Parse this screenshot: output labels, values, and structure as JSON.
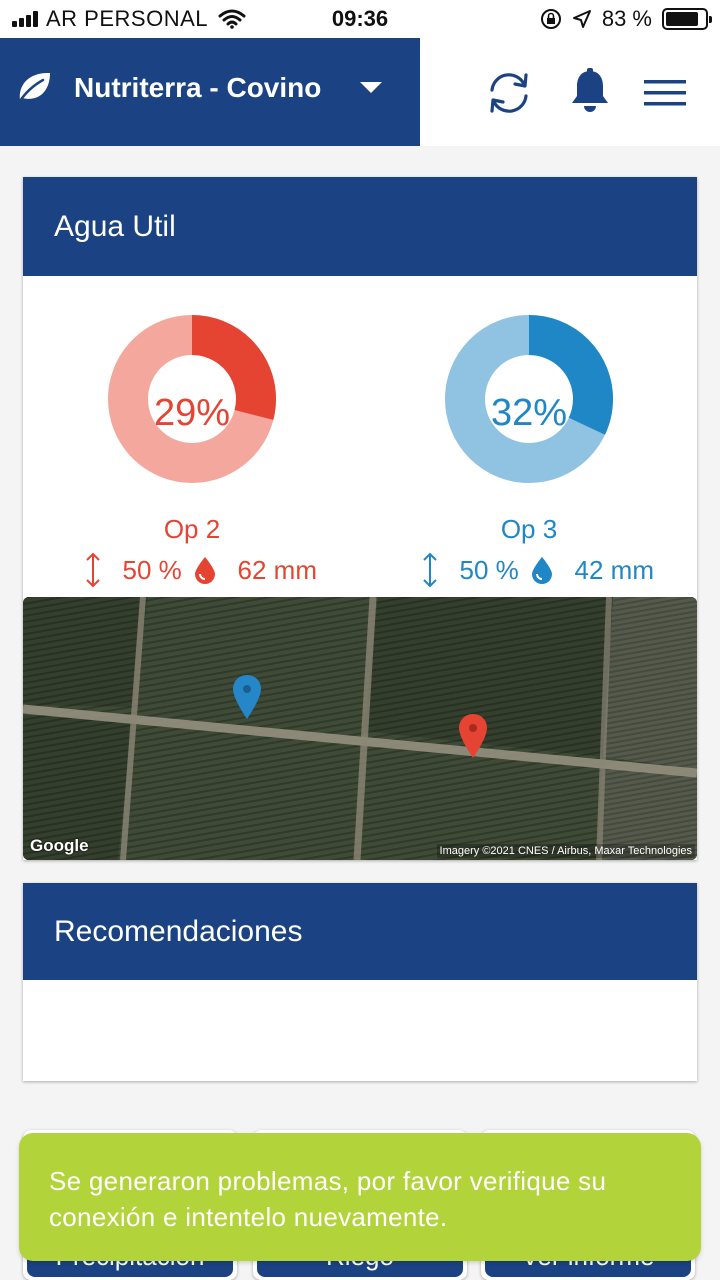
{
  "status_bar": {
    "carrier": "AR PERSONAL",
    "time": "09:36",
    "battery": "83 %",
    "battery_level": 0.83
  },
  "header": {
    "title": "Nutriterra - Covino",
    "icons": [
      "leaf-icon",
      "dropdown-caret-icon",
      "refresh-icon",
      "bell-icon",
      "menu-icon"
    ]
  },
  "agua_util": {
    "title": "Agua Util",
    "sensors": [
      {
        "percent_text": "29%",
        "percent": 29,
        "name": "Op 2",
        "depth": "50 %",
        "water": "62 mm",
        "color": "#e64433",
        "track_color": "#f4a79d"
      },
      {
        "percent_text": "32%",
        "percent": 32,
        "name": "Op 3",
        "depth": "50 %",
        "water": "42 mm",
        "color": "#2087c6",
        "track_color": "#90c3e2"
      }
    ],
    "map": {
      "google_label": "Google",
      "attribution": "Imagery ©2021 CNES / Airbus, Maxar Technologies",
      "markers": [
        "blue-map-marker",
        "red-map-marker"
      ]
    }
  },
  "recomendaciones": {
    "title": "Recomendaciones"
  },
  "bottom_buttons": [
    "Precipitación",
    "Riego",
    "Ver informe"
  ],
  "toast": {
    "message": "Se generaron problemas, por favor verifique su conexión e intentelo nuevamente.",
    "color": "#b3d33a"
  },
  "colors": {
    "primary": "#1b4283",
    "background": "#f4f4f4"
  }
}
